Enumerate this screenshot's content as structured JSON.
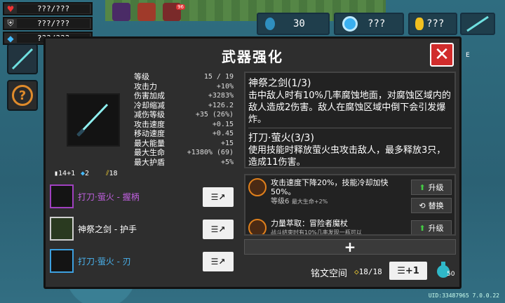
{
  "hud": {
    "hp": "???/???",
    "armor": "???/???",
    "energy": "???/???",
    "buff_badge": "96"
  },
  "currency": {
    "gems": "30",
    "material": "???",
    "gold": "???"
  },
  "panel": {
    "title": "武器强化",
    "close_label": "✕"
  },
  "stats": [
    {
      "label": "等级",
      "value": "15 / 19"
    },
    {
      "label": "攻击力",
      "value": "+10%"
    },
    {
      "label": "伤害加成",
      "value": "+3283%"
    },
    {
      "label": "冷却缩减",
      "value": "+126.2"
    },
    {
      "label": "减伤等级",
      "value": "+35 (26%)"
    },
    {
      "label": "攻击速度",
      "value": "+0.15"
    },
    {
      "label": "移动速度",
      "value": "+0.45"
    },
    {
      "label": "最大能量",
      "value": "+15"
    },
    {
      "label": "最大生命",
      "value": "+1380% (69)"
    },
    {
      "label": "最大护盾",
      "value": "+5%"
    }
  ],
  "mini": {
    "a": "14+1",
    "b": "2",
    "c": "18"
  },
  "parts": [
    {
      "label": "打刀·萤火 - 握柄",
      "color": "#a040c0",
      "btn": "☰↗"
    },
    {
      "label": "神祭之剑 - 护手",
      "color": "#cfcfcf",
      "btn": "☰↗"
    },
    {
      "label": "打刀·萤火 - 刃",
      "color": "#3da0e0",
      "btn": "☰↗"
    }
  ],
  "desc": {
    "title1": "神祭之剑(1/3)",
    "body1": "击中敌人时有10%几率腐蚀地面，对腐蚀区域内的敌人造成2伤害。敌人在腐蚀区域中倒下会引发爆炸。",
    "title2": "打刀·萤火(3/3)",
    "body2": "使用技能时释放萤火虫攻击敌人，最多释放3只，造成11伤害。"
  },
  "inscriptions": [
    {
      "text": "攻击速度下降20%，技能冷却加快50%。",
      "level": "等级6",
      "sub": "最大生命+2%"
    },
    {
      "text": "力量萃取：冒险者魔杖",
      "level": "",
      "sub": "战斗结束时有10%几率发现一瓶可以"
    }
  ],
  "buttons": {
    "upgrade": "升级",
    "replace": "替换",
    "add": "+",
    "expand": "☰+1"
  },
  "footer": {
    "slot_label": "铭文空间",
    "slot_count": "18/18",
    "potion_count": "50"
  },
  "uid": "UID:33487965 7.0.0.22",
  "edge_label": "E"
}
